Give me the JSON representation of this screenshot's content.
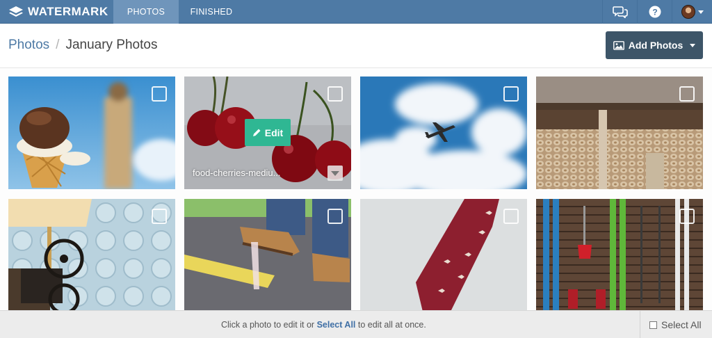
{
  "nav": {
    "brand": "WATERMARK",
    "tabs": [
      {
        "label": "PHOTOS",
        "active": true
      },
      {
        "label": "FINISHED",
        "active": false
      }
    ],
    "icons": [
      "chat-bubbles-icon",
      "help-icon",
      "user-avatar"
    ]
  },
  "header": {
    "breadcrumb_parent": "Photos",
    "breadcrumb_separator": "/",
    "breadcrumb_current": "January Photos",
    "add_button_label": "Add Photos"
  },
  "photos": [
    {
      "subject": "ice cream cone"
    },
    {
      "subject": "cherries",
      "hovered": true,
      "filename": "food-cherries-mediu...",
      "edit_label": "Edit"
    },
    {
      "subject": "airplane in sky"
    },
    {
      "subject": "firewood stack"
    },
    {
      "subject": "film projector"
    },
    {
      "subject": "shoe on gum"
    },
    {
      "subject": "red necktie"
    },
    {
      "subject": "skis on wall"
    }
  ],
  "footer": {
    "hint_before": "Click a photo to edit it or ",
    "hint_link": "Select All",
    "hint_after": " to edit all at once.",
    "select_all_label": "Select All"
  },
  "colors": {
    "nav_bg": "#4e7aa5",
    "active_tab": "#6f95bb",
    "add_button": "#3d5568",
    "edit_button": "#2fb793",
    "link": "#4e7aa5"
  }
}
